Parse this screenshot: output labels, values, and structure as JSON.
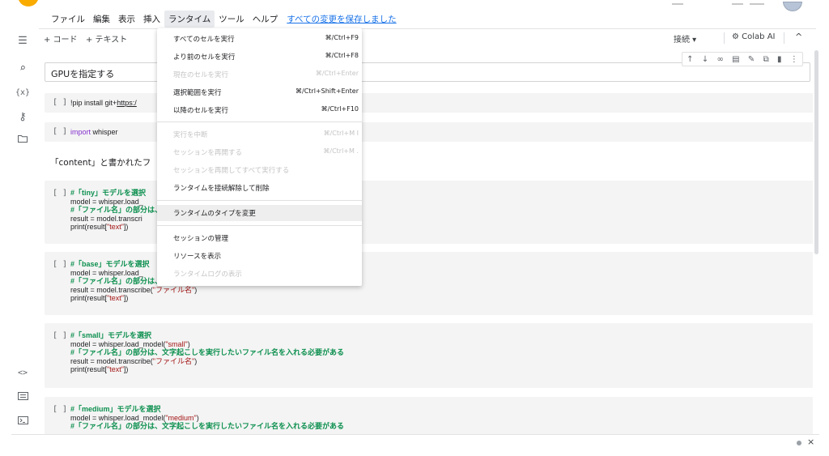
{
  "menubar": {
    "items": [
      "ファイル",
      "編集",
      "表示",
      "挿入",
      "ランタイム",
      "ツール",
      "ヘルプ"
    ],
    "saved_status": "すべての変更を保存しました"
  },
  "toolbar": {
    "add_code": "+ コード",
    "add_text": "+ テキスト",
    "connect": "接続 ▾",
    "colab_ai": "Colab AI",
    "collapse": "^"
  },
  "sidebar": {
    "icons": [
      "list-icon",
      "search-icon",
      "variables-icon",
      "key-icon",
      "folder-icon",
      "code-snippets-icon",
      "command-palette-icon",
      "terminal-icon"
    ]
  },
  "runtime_menu": {
    "items": [
      {
        "label": "すべてのセルを実行",
        "shortcut": "⌘/Ctrl+F9",
        "disabled": false
      },
      {
        "label": "より前のセルを実行",
        "shortcut": "⌘/Ctrl+F8",
        "disabled": false
      },
      {
        "label": "現在のセルを実行",
        "shortcut": "⌘/Ctrl+Enter",
        "disabled": true
      },
      {
        "label": "選択範囲を実行",
        "shortcut": "⌘/Ctrl+Shift+Enter",
        "disabled": false
      },
      {
        "label": "以降のセルを実行",
        "shortcut": "⌘/Ctrl+F10",
        "disabled": false
      },
      {
        "label": "実行を中断",
        "shortcut": "⌘/Ctrl+M I",
        "disabled": true
      },
      {
        "label": "セッションを再開する",
        "shortcut": "⌘/Ctrl+M .",
        "disabled": true
      },
      {
        "label": "セッションを再開してすべて実行する",
        "shortcut": "",
        "disabled": true
      },
      {
        "label": "ランタイムを接続解除して削除",
        "shortcut": "",
        "disabled": false
      },
      {
        "label": "ランタイムのタイプを変更",
        "shortcut": "",
        "disabled": false,
        "hovered": true
      },
      {
        "label": "セッションの管理",
        "shortcut": "",
        "disabled": false
      },
      {
        "label": "リソースを表示",
        "shortcut": "",
        "disabled": false
      },
      {
        "label": "ランタイムログの表示",
        "shortcut": "",
        "disabled": true
      }
    ]
  },
  "notebook": {
    "heading": "GPUを指定する",
    "bracket": "[ ]",
    "cell1": {
      "prefix": "!pip install git+",
      "link": "https:/"
    },
    "cell2": {
      "keyword": "import",
      "rest": " whisper"
    },
    "text_cell": "「content」と書かれたフ",
    "cell3": {
      "l1": "#「tiny」モデルを選択",
      "l2": "model = whisper.load_",
      "l3": "#「ファイル名」の部分は、",
      "l4": "result = model.transcri",
      "l5a": "print(result[",
      "l5b": "\"text\"",
      "l5c": "])"
    },
    "cell4": {
      "l1": "#「base」モデルを選択",
      "l2": "model = whisper.load_",
      "l3": "#「ファイル名」の部分は、",
      "l4a": "result = model.transcribe(",
      "l4b": "\"ファイル名\"",
      "l4c": ")",
      "l5a": "print(result[",
      "l5b": "\"text\"",
      "l5c": "])"
    },
    "cell5": {
      "l1": "#「small」モデルを選択",
      "l2a": "model = whisper.load_model(",
      "l2b": "\"small\"",
      "l2c": ")",
      "l3": "#「ファイル名」の部分は、文字起こしを実行したいファイル名を入れる必要がある",
      "l4a": "result = model.transcribe(",
      "l4b": "\"ファイル名\"",
      "l4c": ")",
      "l5a": "print(result[",
      "l5b": "\"text\"",
      "l5c": "])"
    },
    "cell6": {
      "l1": "#「medium」モデルを選択",
      "l2a": "model = whisper.load_model(",
      "l2b": "\"medium\"",
      "l2c": ")",
      "l3": "#「ファイル名」の部分は、文字起こしを実行したいファイル名を入れる必要がある"
    }
  },
  "statusbar": {
    "close": "×"
  }
}
